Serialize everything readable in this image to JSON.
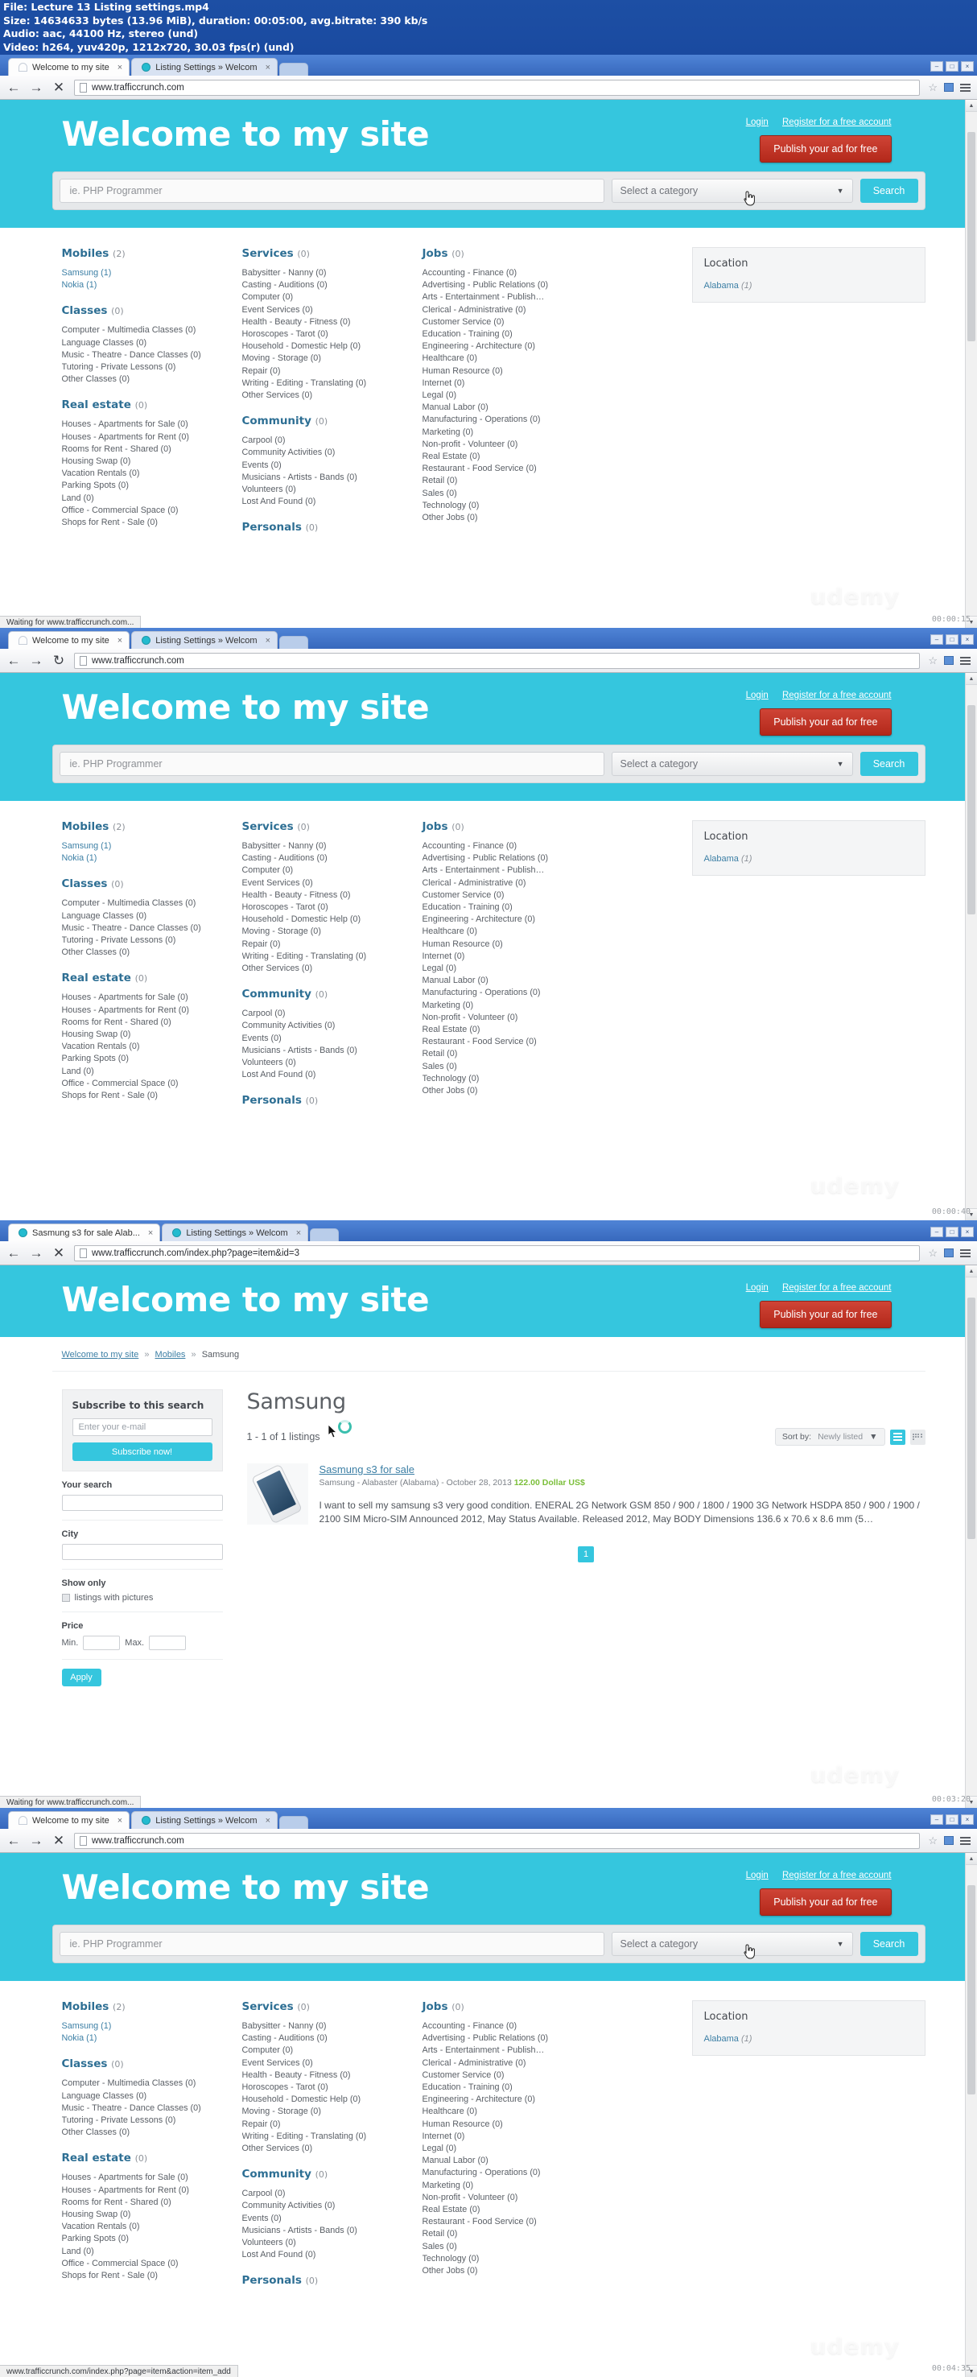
{
  "fileinfo": {
    "line1": "File: Lecture 13 Listing settings.mp4",
    "line2": "Size: 14634633 bytes (13.96 MiB), duration: 00:05:00, avg.bitrate: 390 kb/s",
    "line3": "Audio: aac, 44100 Hz, stereo (und)",
    "line4": "Video: h264, yuv420p, 1212x720, 30.03 fps(r) (und)"
  },
  "browser": {
    "tab_active_label": "Welcome to my site",
    "tab_inactive_label": "Listing Settings » Welcom",
    "tab_active_label_3": "Sasmung s3 for sale Alab...",
    "close_glyph": "×",
    "back_glyph": "←",
    "forward_glyph": "→",
    "stop_glyph": "✕",
    "reload_glyph": "↻",
    "star_glyph": "☆",
    "min_glyph": "–",
    "max_glyph": "□",
    "close_win_glyph": "×",
    "url_home": "www.trafficcrunch.com",
    "url_item": "www.trafficcrunch.com/index.php?page=item&id=3"
  },
  "status": {
    "panel1": "Waiting for www.trafficcrunch.com...",
    "panel3": "Waiting for www.trafficcrunch.com...",
    "panel4": "www.trafficcrunch.com/index.php?page=item&action=item_add"
  },
  "site": {
    "title": "Welcome to my site",
    "login": "Login",
    "register": "Register for a free account",
    "publish": "Publish your ad for free",
    "search_placeholder": "ie. PHP Programmer",
    "category_placeholder": "Select a category",
    "category_carat": "▼",
    "search_button": "Search"
  },
  "location_box": {
    "heading": "Location",
    "item_name": "Alabama",
    "item_count": "(1)"
  },
  "directory": {
    "col1": [
      {
        "name": "Mobiles",
        "count": "(2)",
        "items": [
          {
            "label": "Samsung (1)",
            "link": true
          },
          {
            "label": "Nokia (1)",
            "link": true
          }
        ]
      },
      {
        "name": "Classes",
        "count": "(0)",
        "items": [
          {
            "label": "Computer - Multimedia Classes (0)",
            "link": false
          },
          {
            "label": "Language Classes (0)",
            "link": false
          },
          {
            "label": "Music - Theatre - Dance Classes (0)",
            "link": false
          },
          {
            "label": "Tutoring - Private Lessons (0)",
            "link": false
          },
          {
            "label": "Other Classes (0)",
            "link": false
          }
        ]
      },
      {
        "name": "Real estate",
        "count": "(0)",
        "items": [
          {
            "label": "Houses - Apartments for Sale (0)",
            "link": false
          },
          {
            "label": "Houses - Apartments for Rent (0)",
            "link": false
          },
          {
            "label": "Rooms for Rent - Shared (0)",
            "link": false
          },
          {
            "label": "Housing Swap (0)",
            "link": false
          },
          {
            "label": "Vacation Rentals (0)",
            "link": false
          },
          {
            "label": "Parking Spots (0)",
            "link": false
          },
          {
            "label": "Land (0)",
            "link": false
          },
          {
            "label": "Office - Commercial Space (0)",
            "link": false
          },
          {
            "label": "Shops for Rent - Sale (0)",
            "link": false
          }
        ]
      }
    ],
    "col2": [
      {
        "name": "Services",
        "count": "(0)",
        "items": [
          {
            "label": "Babysitter - Nanny (0)",
            "link": false
          },
          {
            "label": "Casting - Auditions (0)",
            "link": false
          },
          {
            "label": "Computer (0)",
            "link": false
          },
          {
            "label": "Event Services (0)",
            "link": false
          },
          {
            "label": "Health - Beauty - Fitness (0)",
            "link": false
          },
          {
            "label": "Horoscopes - Tarot (0)",
            "link": false
          },
          {
            "label": "Household - Domestic Help (0)",
            "link": false
          },
          {
            "label": "Moving - Storage (0)",
            "link": false
          },
          {
            "label": "Repair (0)",
            "link": false
          },
          {
            "label": "Writing - Editing - Translating (0)",
            "link": false
          },
          {
            "label": "Other Services (0)",
            "link": false
          }
        ]
      },
      {
        "name": "Community",
        "count": "(0)",
        "items": [
          {
            "label": "Carpool (0)",
            "link": false
          },
          {
            "label": "Community Activities (0)",
            "link": false
          },
          {
            "label": "Events (0)",
            "link": false
          },
          {
            "label": "Musicians - Artists - Bands (0)",
            "link": false
          },
          {
            "label": "Volunteers (0)",
            "link": false
          },
          {
            "label": "Lost And Found (0)",
            "link": false
          }
        ]
      },
      {
        "name": "Personals",
        "count": "(0)",
        "items": []
      }
    ],
    "col3": [
      {
        "name": "Jobs",
        "count": "(0)",
        "items": [
          {
            "label": "Accounting - Finance (0)",
            "link": false
          },
          {
            "label": "Advertising - Public Relations (0)",
            "link": false
          },
          {
            "label": "Arts - Entertainment - Publish…",
            "link": false
          },
          {
            "label": "Clerical - Administrative (0)",
            "link": false
          },
          {
            "label": "Customer Service (0)",
            "link": false
          },
          {
            "label": "Education - Training (0)",
            "link": false
          },
          {
            "label": "Engineering - Architecture (0)",
            "link": false
          },
          {
            "label": "Healthcare (0)",
            "link": false
          },
          {
            "label": "Human Resource (0)",
            "link": false
          },
          {
            "label": "Internet (0)",
            "link": false
          },
          {
            "label": "Legal (0)",
            "link": false
          },
          {
            "label": "Manual Labor (0)",
            "link": false
          },
          {
            "label": "Manufacturing - Operations (0)",
            "link": false
          },
          {
            "label": "Marketing (0)",
            "link": false
          },
          {
            "label": "Non-profit - Volunteer (0)",
            "link": false
          },
          {
            "label": "Real Estate (0)",
            "link": false
          },
          {
            "label": "Restaurant - Food Service (0)",
            "link": false
          },
          {
            "label": "Retail (0)",
            "link": false
          },
          {
            "label": "Sales (0)",
            "link": false
          },
          {
            "label": "Technology (0)",
            "link": false
          },
          {
            "label": "Other Jobs (0)",
            "link": false
          }
        ]
      }
    ]
  },
  "listing_page": {
    "breadcrumb": {
      "home": "Welcome to my site",
      "cat": "Mobiles",
      "current": "Samsung",
      "sep": "»"
    },
    "heading": "Samsung",
    "count_text": "1 - 1 of 1 listings",
    "sort_label": "Sort by:",
    "sort_value": "Newly listed",
    "sort_carat": "▼",
    "subscribe": {
      "heading": "Subscribe to this search",
      "email_placeholder": "Enter your e-mail",
      "button": "Subscribe now!"
    },
    "filters": {
      "your_search_label": "Your search",
      "your_search_value": "",
      "city_label": "City",
      "city_value": "",
      "show_only_label": "Show only",
      "pictures_label": "listings with pictures",
      "price_label": "Price",
      "min_label": "Min.",
      "max_label": "Max.",
      "min_value": "",
      "max_value": "",
      "apply": "Apply"
    },
    "item": {
      "title": "Sasmung s3 for sale",
      "meta": "Samsung - Alabaster (Alabama) - October 28, 2013",
      "price": "122.00 Dollar US$",
      "description": "I want to sell my samsung s3 very good condition. ENERAL 2G Network GSM 850 / 900 / 1800 / 1900 3G Network HSDPA 850 / 900 / 1900 / 2100 SIM Micro-SIM Announced 2012, May Status Available. Released 2012, May BODY Dimensions 136.6 x 70.6 x 8.6 mm (5…"
    },
    "page_number": "1"
  },
  "watermark": {
    "text": "udemy",
    "timestamps": [
      "00:00:15",
      "00:00:40",
      "00:03:20",
      "00:04:35"
    ]
  },
  "colors": {
    "brand_cyan": "#35c6de",
    "publish_red": "#c0392b",
    "link_blue": "#3c7fa5",
    "heading_blue": "#2e6f94",
    "price_green": "#7bbf3a"
  }
}
